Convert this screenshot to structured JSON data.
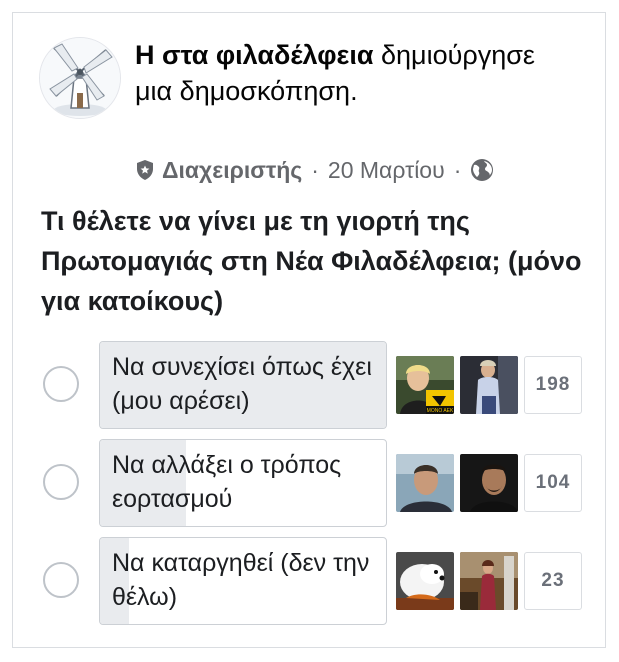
{
  "post": {
    "author": "Η στα φιλαδέλφεια",
    "action": "δημιούργησε μια δημοσκόπηση.",
    "role": "Διαχειριστής",
    "date": "20 Μαρτίου",
    "separator": "·",
    "icons": [
      "admin-shield-icon",
      "globe-icon"
    ]
  },
  "poll": {
    "question": "Τι θέλετε να γίνει με τη γιορτή της Πρωτομαγιάς στη Νέα Φιλαδέλφεια; (μόνο για κατοίκους)",
    "options": [
      {
        "label": "Να συνεχίσει όπως έχει (μου αρέσει)",
        "count": "198",
        "share": 0.6
      },
      {
        "label": "Να αλλάξει ο τρόπος εορτασμού",
        "count": "104",
        "share": 0.31
      },
      {
        "label": "Να καταργηθεί (δεν την θέλω)",
        "count": "23",
        "share": 0.07
      }
    ],
    "voter_thumb_badge": "ΜΟΝΟ ΑΕΚ"
  },
  "colors": {
    "text_primary": "#050505",
    "text_secondary": "#65676b",
    "option_fill": "#e9ebee",
    "border": "#ccd0d5"
  }
}
